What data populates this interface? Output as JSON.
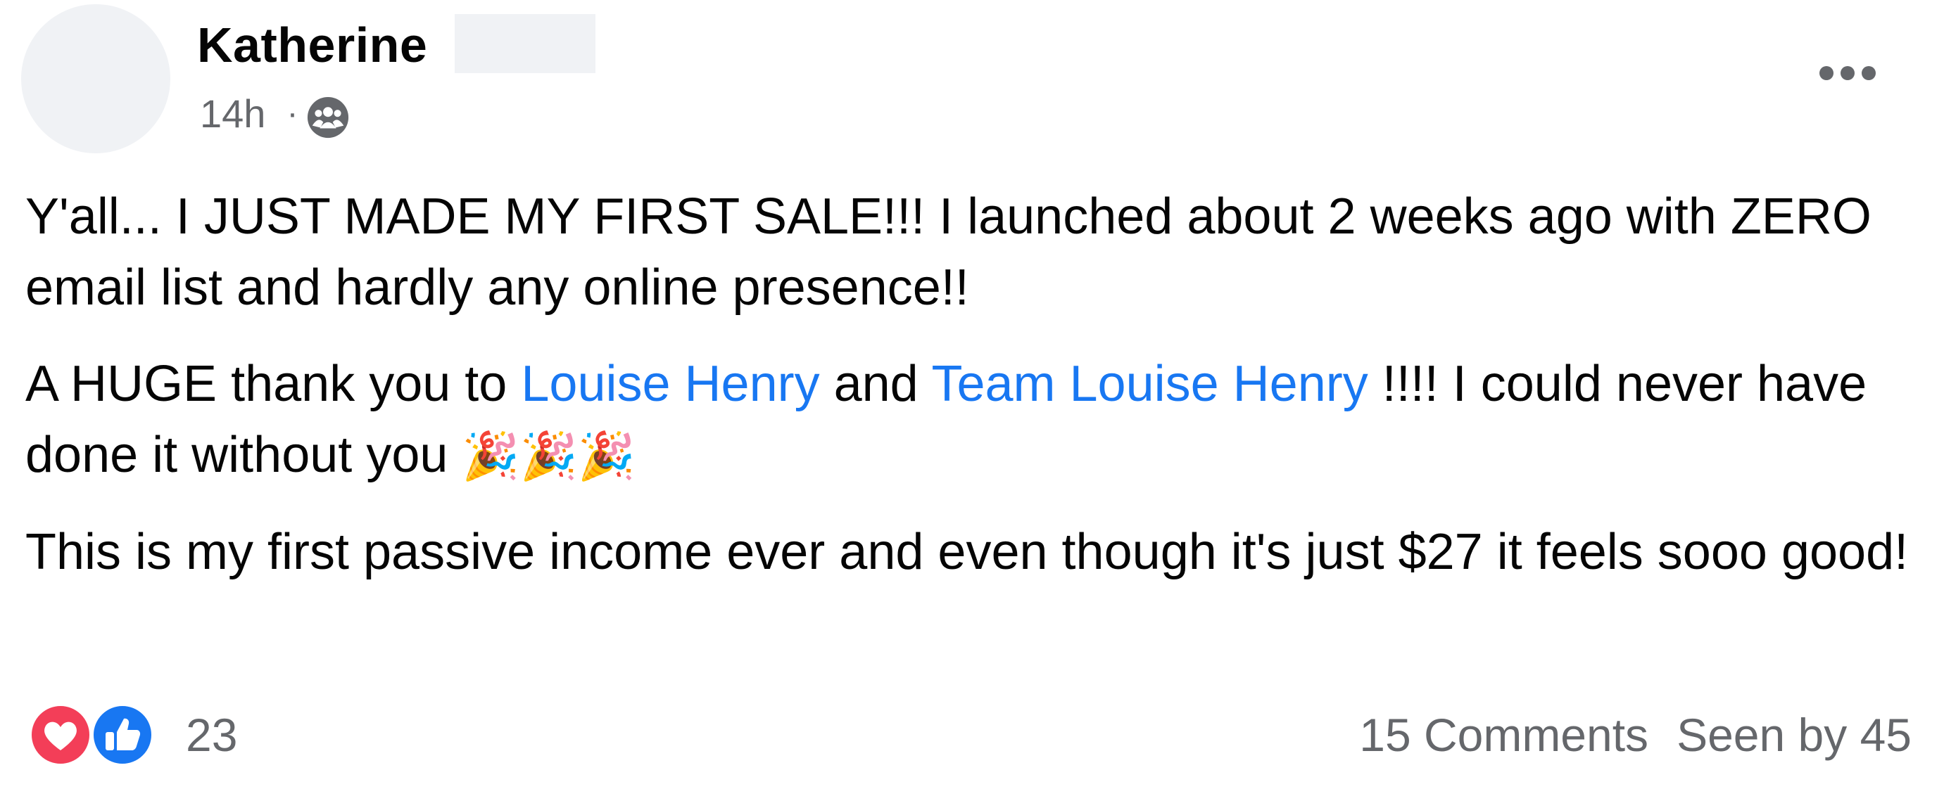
{
  "post": {
    "author": {
      "name": "Katherine"
    },
    "timestamp": "14h",
    "meta_separator": "·",
    "audience_icon": "group-icon",
    "more_icon": "more-horizontal-icon",
    "body": {
      "p1": "Y'all... I JUST MADE MY FIRST SALE!!! I launched about 2 weeks ago with ZERO email list and hardly any online presence!!",
      "p2_prefix": "A HUGE thank you to ",
      "mention1": "Louise Henry",
      "p2_and": " and ",
      "mention2": "Team Louise Henry",
      "p2_suffix": " !!!! I could never have done it without you ",
      "p2_emojis": "🎉🎉🎉",
      "p3": "This is my first passive income ever and even though it's just $27 it feels sooo good!"
    },
    "reactions": {
      "icons": [
        "heart-reaction-icon",
        "like-reaction-icon"
      ],
      "count": "23"
    },
    "comments_label": "15 Comments",
    "seen_by_label": "Seen by 45",
    "colors": {
      "link": "#1877f2",
      "meta": "#65676b",
      "text": "#050505",
      "love": "#f33e58",
      "like": "#1877f2"
    }
  }
}
